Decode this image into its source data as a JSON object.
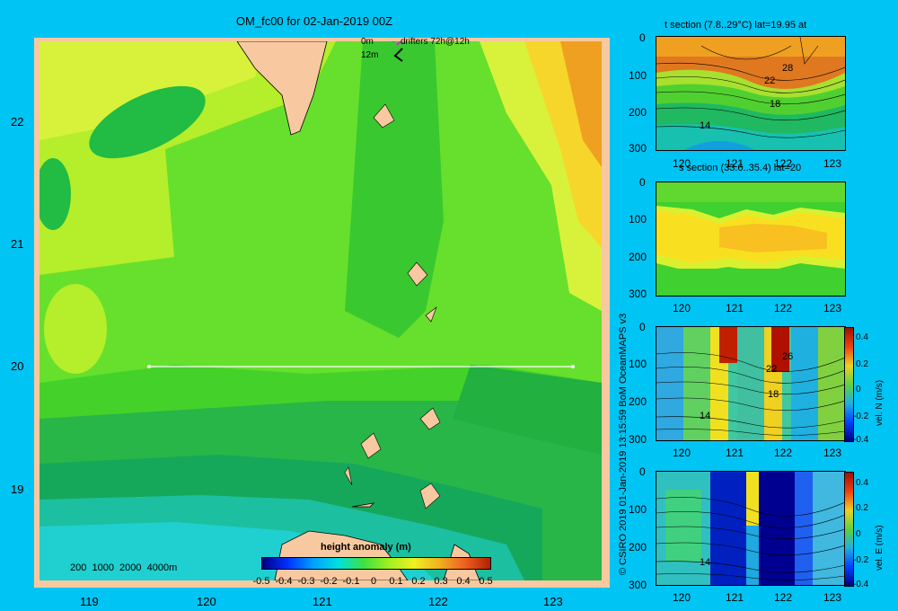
{
  "map": {
    "title": "OM_fc00 for 02-Jan-2019 00Z",
    "drifter_label_0m": "0m",
    "drifter_label_12m": "12m",
    "drifter_text": "drifters 72h@12h",
    "depth_legend": "200  1000  2000  4000m",
    "lat_labels": [
      "22",
      "21",
      "20",
      "19"
    ],
    "lon_labels": [
      "119",
      "120",
      "121",
      "122",
      "123"
    ],
    "colorbar_title": "height anomaly (m)",
    "colorbar_ticks": [
      "-0.5",
      "-0.4",
      "-0.3",
      "-0.2",
      "-0.1",
      "0",
      "0.1",
      "0.2",
      "0.3",
      "0.4",
      "0.5"
    ]
  },
  "panels": [
    {
      "title": "t section (7.8..29°C) lat=19.95 at",
      "y_ticks": [
        "0",
        "100",
        "200",
        "300"
      ],
      "x_ticks": [
        "120",
        "121",
        "122",
        "123"
      ],
      "contour_labels": [
        "28",
        "22",
        "18",
        "14"
      ]
    },
    {
      "title": "s section (33.6..35.4) lat=20",
      "y_ticks": [
        "0",
        "100",
        "200",
        "300"
      ],
      "x_ticks": [
        "120",
        "121",
        "122",
        "123"
      ]
    },
    {
      "title": "",
      "y_ticks": [
        "0",
        "100",
        "200",
        "300"
      ],
      "x_ticks": [
        "120",
        "121",
        "122",
        "123"
      ],
      "contour_labels": [
        "26",
        "22",
        "18",
        "14"
      ],
      "cbar_ticks": [
        "0.4",
        "0.2",
        "0",
        "-0.2",
        "-0.4"
      ],
      "cbar_label": "vel. N (m/s)"
    },
    {
      "title": "",
      "y_ticks": [
        "0",
        "100",
        "200",
        "300"
      ],
      "x_ticks": [
        "120",
        "121",
        "122",
        "123"
      ],
      "contour_labels": [
        "14"
      ],
      "cbar_ticks": [
        "0.4",
        "0.2",
        "0",
        "-0.2",
        "-0.4"
      ],
      "cbar_label": "vel. E (m/s)"
    }
  ],
  "credit": "© CSIRO 2019   01-Jan-2019 13:15:59 BoM OceanMAPS v3"
}
